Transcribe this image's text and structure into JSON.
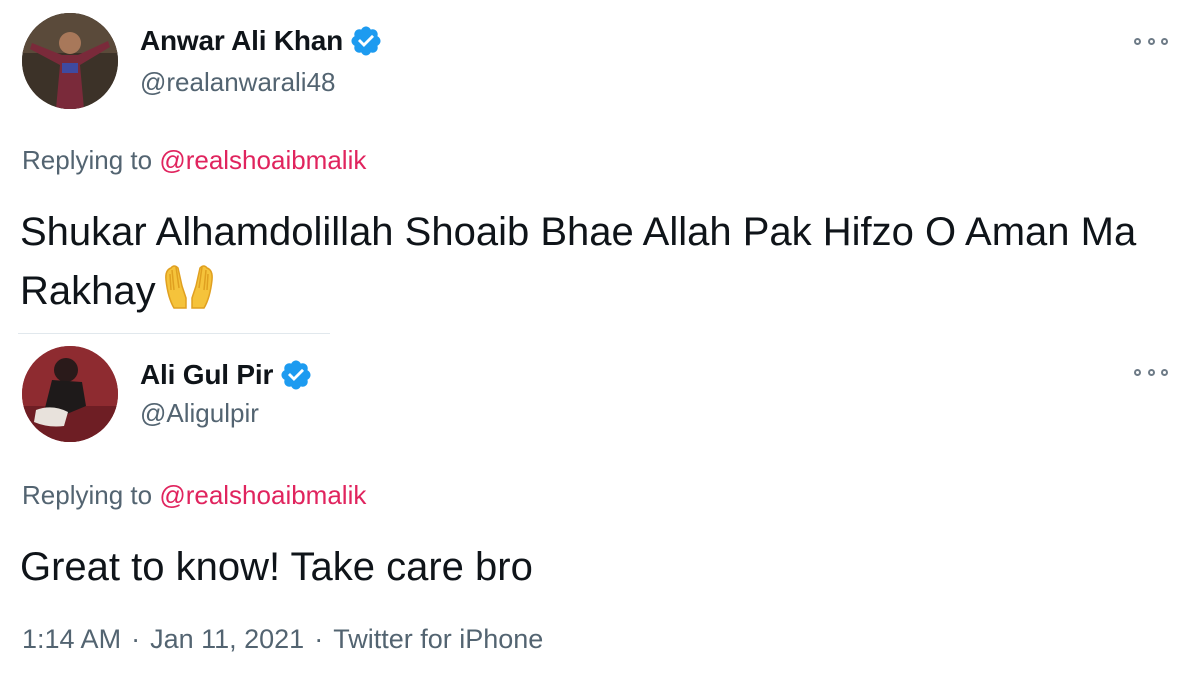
{
  "tweets": [
    {
      "author_name": "Anwar Ali Khan",
      "handle": "@realanwarali48",
      "replying_prefix": "Replying to",
      "replying_to": "@realshoaibmalik",
      "text": "Shukar Alhamdolillah Shoaib Bhae Allah Pak Hifzo O Aman Ma Rakhay",
      "emoji_icon": "raising-hands-icon",
      "verified_icon": "verified-badge-icon",
      "more_icon": "more-options-icon"
    },
    {
      "author_name": "Ali Gul Pir",
      "handle": "@Aligulpir",
      "replying_prefix": "Replying to",
      "replying_to": "@realshoaibmalik",
      "text": "Great to know! Take care bro",
      "verified_icon": "verified-badge-icon",
      "more_icon": "more-options-icon",
      "time": "1:14 AM",
      "date": "Jan 11, 2021",
      "source": "Twitter for iPhone",
      "separator": "·"
    }
  ],
  "colors": {
    "text": "#0f1419",
    "secondary": "#536471",
    "mention": "#e0245e",
    "verified": "#1d9bf0"
  }
}
